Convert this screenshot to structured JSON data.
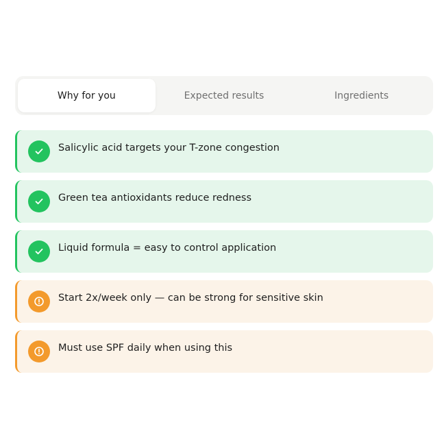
{
  "tabs": [
    {
      "label": "Why for you",
      "active": true
    },
    {
      "label": "Expected results",
      "active": false
    },
    {
      "label": "Ingredients",
      "active": false
    }
  ],
  "items": [
    {
      "type": "positive",
      "icon": "check-icon",
      "text": "Salicylic acid targets your T-zone congestion"
    },
    {
      "type": "positive",
      "icon": "check-icon",
      "text": "Green tea antioxidants reduce redness"
    },
    {
      "type": "positive",
      "icon": "check-icon",
      "text": "Liquid formula = easy to control application"
    },
    {
      "type": "caution",
      "icon": "alert-icon",
      "text": "Start 2x/week only — can be strong for sensitive skin"
    },
    {
      "type": "caution",
      "icon": "alert-icon",
      "text": "Must use SPF daily when using this"
    }
  ],
  "colors": {
    "positive_accent": "#23c35f",
    "positive_bg": "#e5f6eb",
    "caution_accent": "#f39a2c",
    "caution_bg": "#fcf3e8"
  }
}
